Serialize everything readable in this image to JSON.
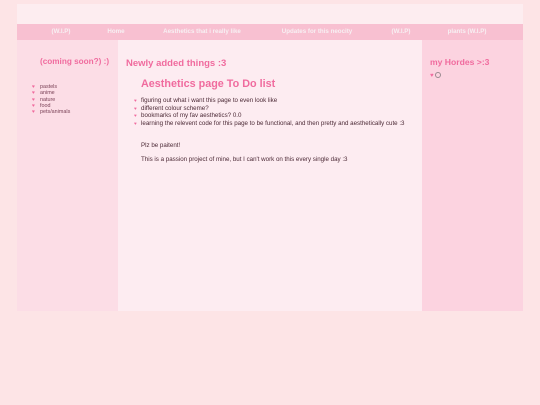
{
  "nav": {
    "items": [
      {
        "label": "(W.I.P)"
      },
      {
        "label": "Home"
      },
      {
        "label": "Aesthetics that i really like"
      },
      {
        "label": "Updates for this neocity"
      },
      {
        "label": "(W.I.P)"
      },
      {
        "label": "plants (W.I.P)"
      }
    ]
  },
  "left": {
    "title": "(coming soon?) :)",
    "items": [
      {
        "label": "pastels"
      },
      {
        "label": "anime"
      },
      {
        "label": "nature"
      },
      {
        "label": "food"
      },
      {
        "label": "pets/animals"
      }
    ]
  },
  "center": {
    "title": "Newly added things :3",
    "todo_title": "Aesthetics page To Do list",
    "todo_items": [
      {
        "label": "figuring out what i want this page to even look like"
      },
      {
        "label": "different colour scheme?"
      },
      {
        "label": "bookmarks of my fav aesthetics? 0.0"
      },
      {
        "label": "learning the relevent code for this page to be functional, and then pretty and aesthetically cute :3"
      }
    ],
    "para1": "Plz be paitent!",
    "para2": "This is a passion project of mine, but I can't work on this every single day :3"
  },
  "right": {
    "title": "my Hordes >:3"
  },
  "icons": {
    "bullet": "heart-icon",
    "hordes": [
      "heart-icon",
      "ring-icon"
    ]
  },
  "colors": {
    "accent": "#f06b9e",
    "nav_bg": "#f8c0d1",
    "page_bg": "#fde4e6"
  }
}
